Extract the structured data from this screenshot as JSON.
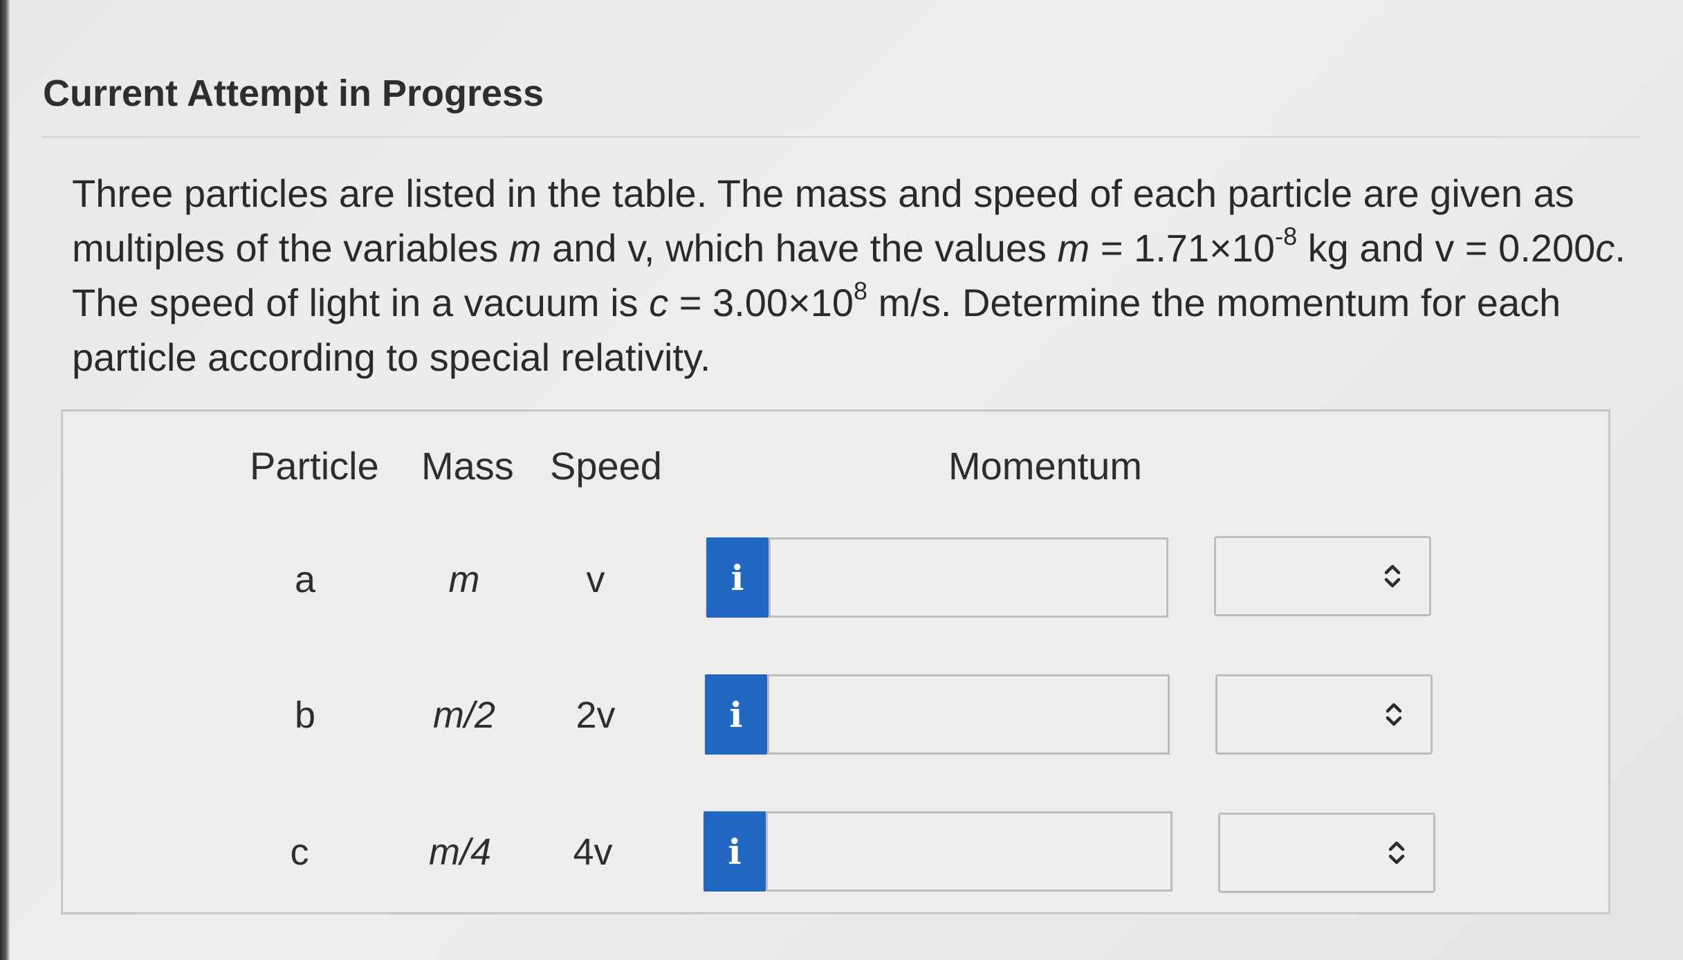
{
  "header": {
    "title": "Current Attempt in Progress"
  },
  "question": {
    "line1": "Three particles are listed in the table. The mass and speed of each particle are given as",
    "line2_a": "multiples of the variables ",
    "line2_m": "m",
    "line2_b": " and ",
    "line2_v": "v",
    "line2_c": ", which have the values ",
    "line2_m2": "m",
    "line2_d": " = 1.71×10",
    "line2_exp": "-8",
    "line2_e": " kg and v = 0.200",
    "line2_c2": "c",
    "line2_f": ".",
    "line3_a": "The speed of light in a vacuum is ",
    "line3_c": "c",
    "line3_b": " = 3.00×10",
    "line3_exp": "8",
    "line3_d": " m/s. Determine the momentum for each",
    "line4": "particle according to special relativity."
  },
  "table": {
    "headers": {
      "particle": "Particle",
      "mass": "Mass",
      "speed": "Speed",
      "momentum": "Momentum"
    },
    "rows": [
      {
        "particle": "a",
        "mass": "m",
        "speed": "v",
        "info": "i",
        "value": "",
        "unit": ""
      },
      {
        "particle": "b",
        "mass": "m/2",
        "speed": "2v",
        "info": "i",
        "value": "",
        "unit": ""
      },
      {
        "particle": "c",
        "mass": "m/4",
        "speed": "4v",
        "info": "i",
        "value": "",
        "unit": ""
      }
    ]
  },
  "colors": {
    "info_button": "#2367c4",
    "background": "#ecebe9"
  },
  "icons": {
    "info": "info-icon",
    "select": "chevron-up-down-icon"
  }
}
